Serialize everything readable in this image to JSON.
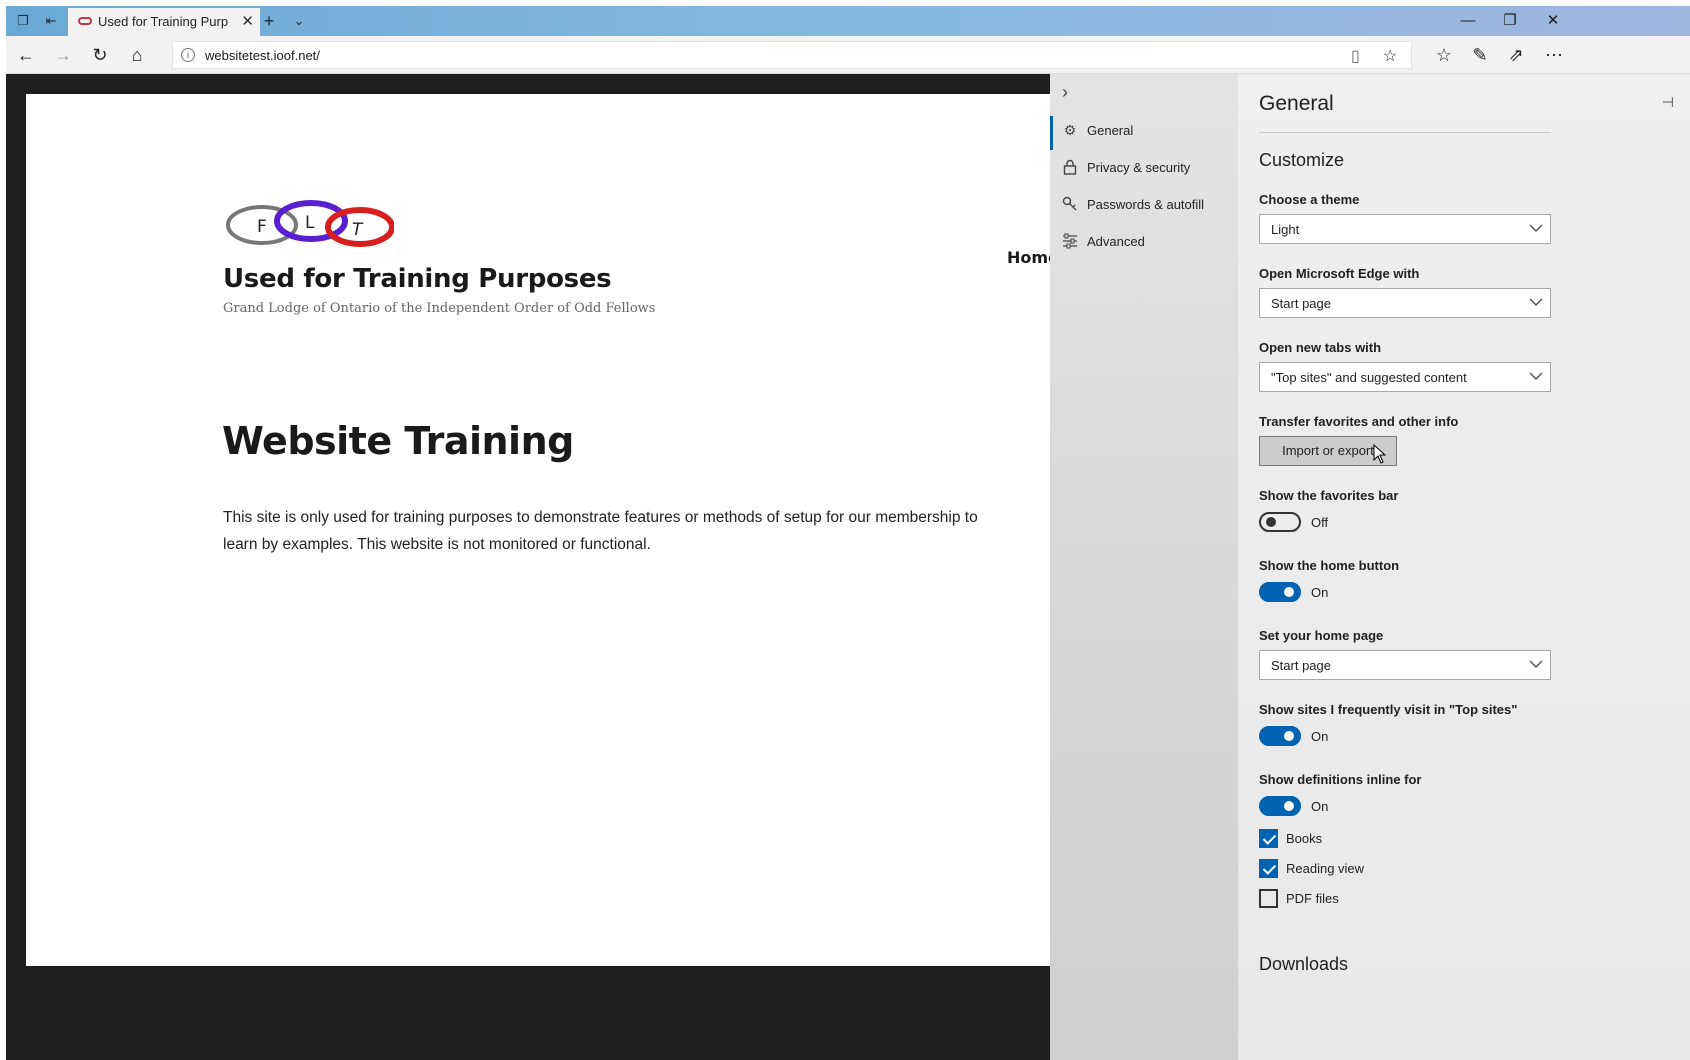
{
  "browser": {
    "tab_title": "Used for Training Purpo",
    "address": "websitetest.ioof.net/"
  },
  "page": {
    "logo_letters": [
      "F",
      "L",
      "T"
    ],
    "site_title": "Used for Training Purposes",
    "site_subtitle": "Grand Lodge of Ontario of the Independent Order of Odd Fellows",
    "nav_home": "Home",
    "headline": "Website Training",
    "paragraph": "This site is only used for training purposes to demonstrate features or methods of setup for our membership to learn by examples. This website is not monitored or functional."
  },
  "settings_nav": {
    "items": [
      {
        "label": "General",
        "icon": "gear-icon",
        "active": true
      },
      {
        "label": "Privacy & security",
        "icon": "lock-icon",
        "active": false
      },
      {
        "label": "Passwords & autofill",
        "icon": "key-icon",
        "active": false
      },
      {
        "label": "Advanced",
        "icon": "sliders-icon",
        "active": false
      }
    ]
  },
  "settings": {
    "title": "General",
    "section_customize": "Customize",
    "theme_label": "Choose a theme",
    "theme_value": "Light",
    "open_with_label": "Open Microsoft Edge with",
    "open_with_value": "Start page",
    "new_tabs_label": "Open new tabs with",
    "new_tabs_value": "\"Top sites\" and suggested content",
    "transfer_label": "Transfer favorites and other info",
    "import_button": "Import or export",
    "fav_bar_label": "Show the favorites bar",
    "fav_bar_state": "Off",
    "home_button_label": "Show the home button",
    "home_button_state": "On",
    "home_page_label": "Set your home page",
    "home_page_value": "Start page",
    "top_sites_label": "Show sites I frequently visit in \"Top sites\"",
    "top_sites_state": "On",
    "definitions_label": "Show definitions inline for",
    "definitions_state": "On",
    "def_books": "Books",
    "def_reading": "Reading view",
    "def_pdf": "PDF files",
    "section_downloads": "Downloads"
  },
  "colors": {
    "accent": "#0063b1",
    "titlebar": "#86b8df"
  }
}
